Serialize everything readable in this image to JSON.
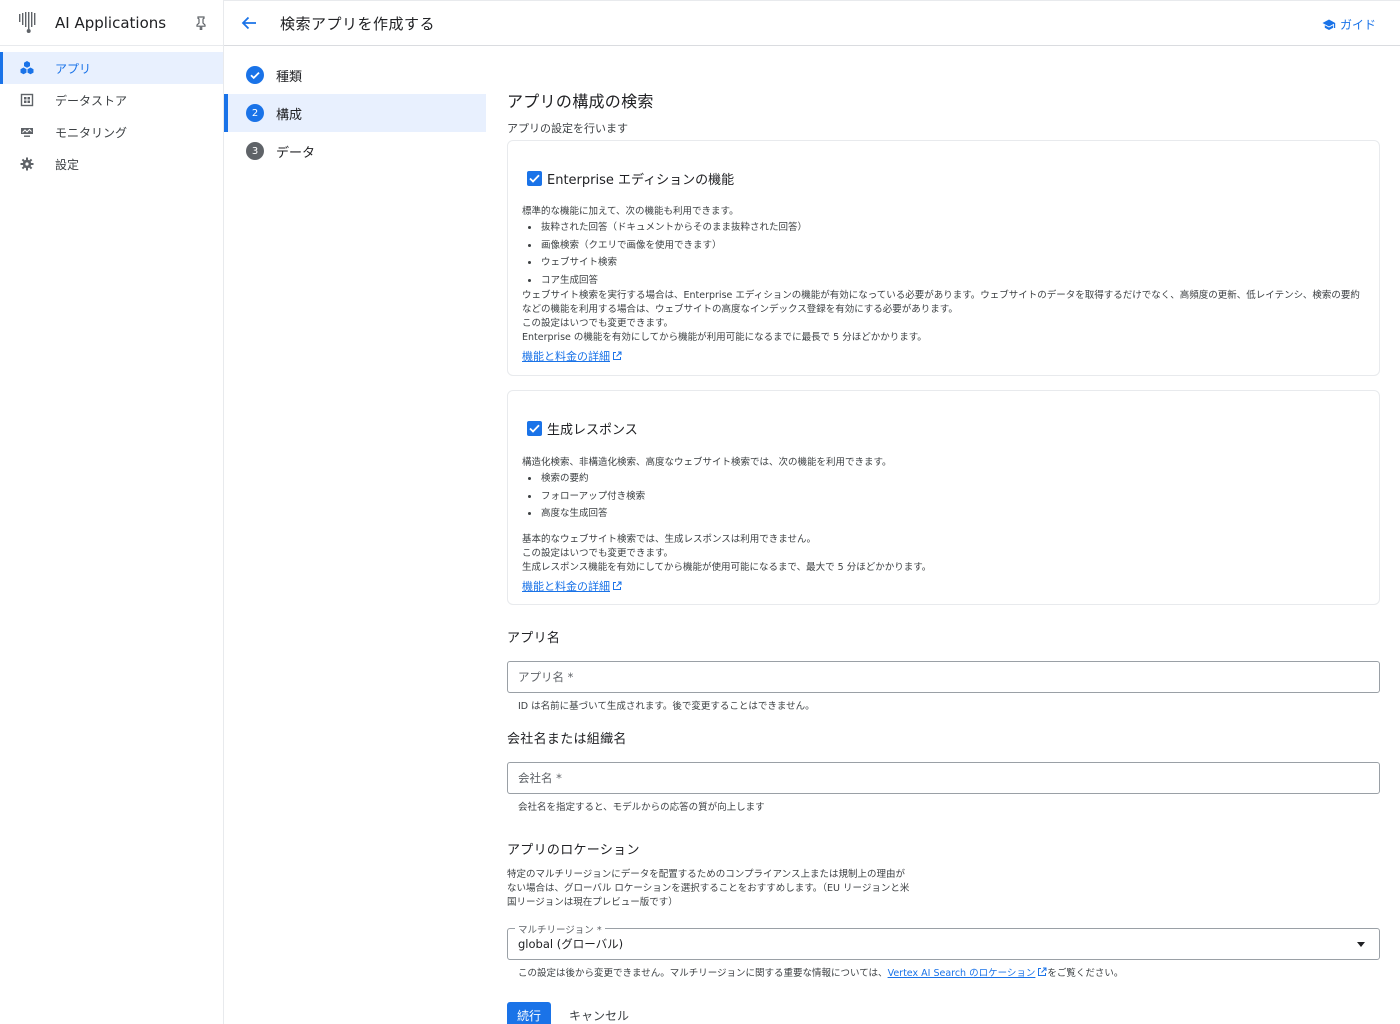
{
  "nav": {
    "brand": "AI Applications",
    "items": [
      {
        "label": "アプリ",
        "icon": "apps-icon"
      },
      {
        "label": "データストア",
        "icon": "datastore-icon"
      },
      {
        "label": "モニタリング",
        "icon": "monitoring-icon"
      },
      {
        "label": "設定",
        "icon": "gear-icon"
      }
    ]
  },
  "topbar": {
    "title": "検索アプリを作成する",
    "guide": "ガイド"
  },
  "steps": [
    {
      "num": "",
      "label": "種類",
      "state": "done"
    },
    {
      "num": "2",
      "label": "構成",
      "state": "active"
    },
    {
      "num": "3",
      "label": "データ",
      "state": "pending"
    }
  ],
  "main": {
    "heading": "アプリの構成の検索",
    "subheading": "アプリの設定を行います",
    "enterprise": {
      "title": "Enterprise エディションの機能",
      "intro": "標準的な機能に加えて、次の機能も利用できます。",
      "bullets": [
        "抜粋された回答（ドキュメントからそのまま抜粋された回答）",
        "画像検索（クエリで画像を使用できます）",
        "ウェブサイト検索",
        "コア生成回答"
      ],
      "para1": "ウェブサイト検索を実行する場合は、Enterprise エディションの機能が有効になっている必要があります。ウェブサイトのデータを取得するだけでなく、高頻度の更新、低レイテンシ、検索の要約などの機能を利用する場合は、ウェブサイトの高度なインデックス登録を有効にする必要があります。",
      "para2": "この設定はいつでも変更できます。",
      "para3": "Enterprise の機能を有効にしてから機能が利用可能になるまでに最長で 5 分ほどかかります。",
      "link": "機能と料金の詳細"
    },
    "generative": {
      "title": "生成レスポンス",
      "intro": "構造化検索、非構造化検索、高度なウェブサイト検索では、次の機能を利用できます。",
      "bullets": [
        "検索の要約",
        "フォローアップ付き検索",
        "高度な生成回答"
      ],
      "para1": "基本的なウェブサイト検索では、生成レスポンスは利用できません。",
      "para2": "この設定はいつでも変更できます。",
      "para3": "生成レスポンス機能を有効にしてから機能が使用可能になるまで、最大で 5 分ほどかかります。",
      "link": "機能と料金の詳細"
    },
    "app_name": {
      "section": "アプリ名",
      "placeholder": "アプリ名 *",
      "hint": "ID は名前に基づいて生成されます。後で変更することはできません。"
    },
    "company": {
      "section": "会社名または組織名",
      "placeholder": "会社名 *",
      "hint": "会社名を指定すると、モデルからの応答の質が向上します"
    },
    "location": {
      "section": "アプリのロケーション",
      "desc_line1": "特定のマルチリージョンにデータを配置するためのコンプライアンス上または規制上の理由が",
      "desc_line2": "ない場合は、グローバル ロケーションを選択することをおすすめします。（EU リージョンと米",
      "desc_line3": "国リージョンは現在プレビュー版です）",
      "select_label": "マルチリージョン *",
      "select_value": "global (グローバル)",
      "hint_prefix": "この設定は後から変更できません。マルチリージョンに関する重要な情報については、",
      "hint_link": "Vertex AI Search のロケーション",
      "hint_suffix": "をご覧ください。"
    },
    "buttons": {
      "continue": "続行",
      "cancel": "キャンセル"
    }
  },
  "colors": {
    "accent": "#1a73e8",
    "active_bg": "#e8f0fe"
  }
}
